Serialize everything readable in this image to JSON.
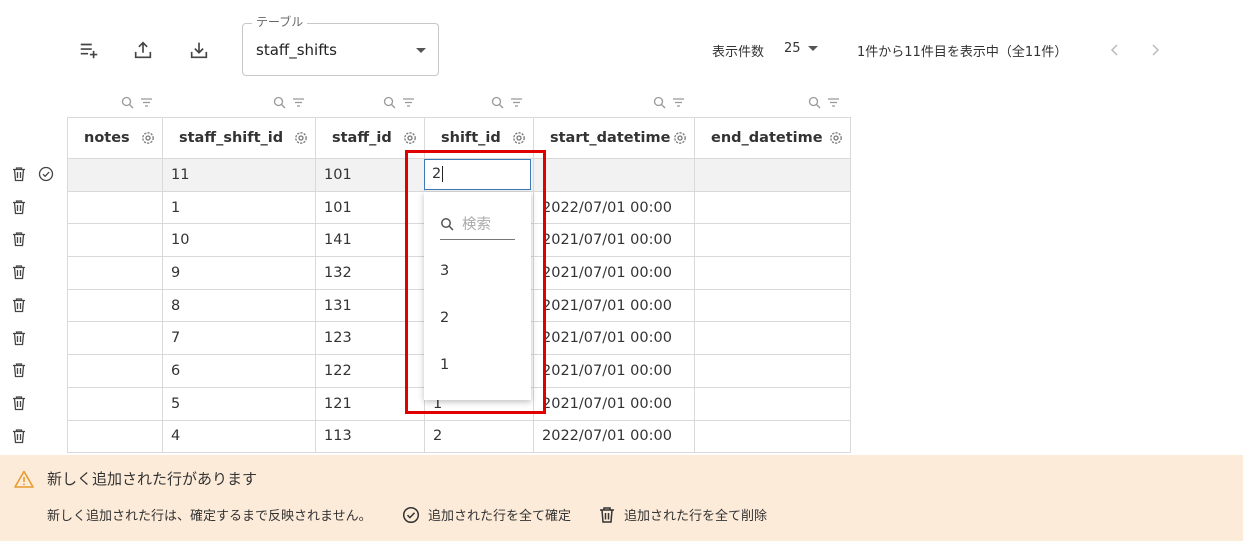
{
  "toolbar": {
    "add_rows_icon": "playlist-add-icon",
    "upload_icon": "upload-icon",
    "download_icon": "download-icon",
    "table_select": {
      "legend": "テーブル",
      "value": "staff_shifts"
    },
    "page_size_label": "表示件数",
    "page_size_value": "25",
    "range_text": "1件から11件目を表示中（全11件）"
  },
  "columns": [
    "notes",
    "staff_shift_id",
    "staff_id",
    "shift_id",
    "start_datetime",
    "end_datetime"
  ],
  "rows": [
    {
      "notes": "",
      "staff_shift_id": "11",
      "staff_id": "101",
      "shift_id": "",
      "start_datetime": "",
      "end_datetime": "",
      "is_new": true
    },
    {
      "notes": "",
      "staff_shift_id": "1",
      "staff_id": "101",
      "shift_id": "",
      "start_datetime": "2022/07/01 00:00",
      "end_datetime": ""
    },
    {
      "notes": "",
      "staff_shift_id": "10",
      "staff_id": "141",
      "shift_id": "",
      "start_datetime": "2021/07/01 00:00",
      "end_datetime": ""
    },
    {
      "notes": "",
      "staff_shift_id": "9",
      "staff_id": "132",
      "shift_id": "",
      "start_datetime": "2021/07/01 00:00",
      "end_datetime": ""
    },
    {
      "notes": "",
      "staff_shift_id": "8",
      "staff_id": "131",
      "shift_id": "",
      "start_datetime": "2021/07/01 00:00",
      "end_datetime": ""
    },
    {
      "notes": "",
      "staff_shift_id": "7",
      "staff_id": "123",
      "shift_id": "",
      "start_datetime": "2021/07/01 00:00",
      "end_datetime": ""
    },
    {
      "notes": "",
      "staff_shift_id": "6",
      "staff_id": "122",
      "shift_id": "",
      "start_datetime": "2021/07/01 00:00",
      "end_datetime": ""
    },
    {
      "notes": "",
      "staff_shift_id": "5",
      "staff_id": "121",
      "shift_id": "1",
      "start_datetime": "2021/07/01 00:00",
      "end_datetime": ""
    },
    {
      "notes": "",
      "staff_shift_id": "4",
      "staff_id": "113",
      "shift_id": "2",
      "start_datetime": "2022/07/01 00:00",
      "end_datetime": ""
    }
  ],
  "editor": {
    "value": "2",
    "search_placeholder": "検索",
    "options": [
      "3",
      "2",
      "1"
    ]
  },
  "banner": {
    "title": "新しく追加された行があります",
    "body": "新しく追加された行は、確定するまで反映されません。",
    "confirm_all": "追加された行を全て確定",
    "delete_all": "追加された行を全て削除"
  },
  "colors": {
    "banner_bg": "#fdebd9",
    "warning": "#e69b2c",
    "highlight": "#e00000",
    "focus": "#3d7ab8"
  }
}
